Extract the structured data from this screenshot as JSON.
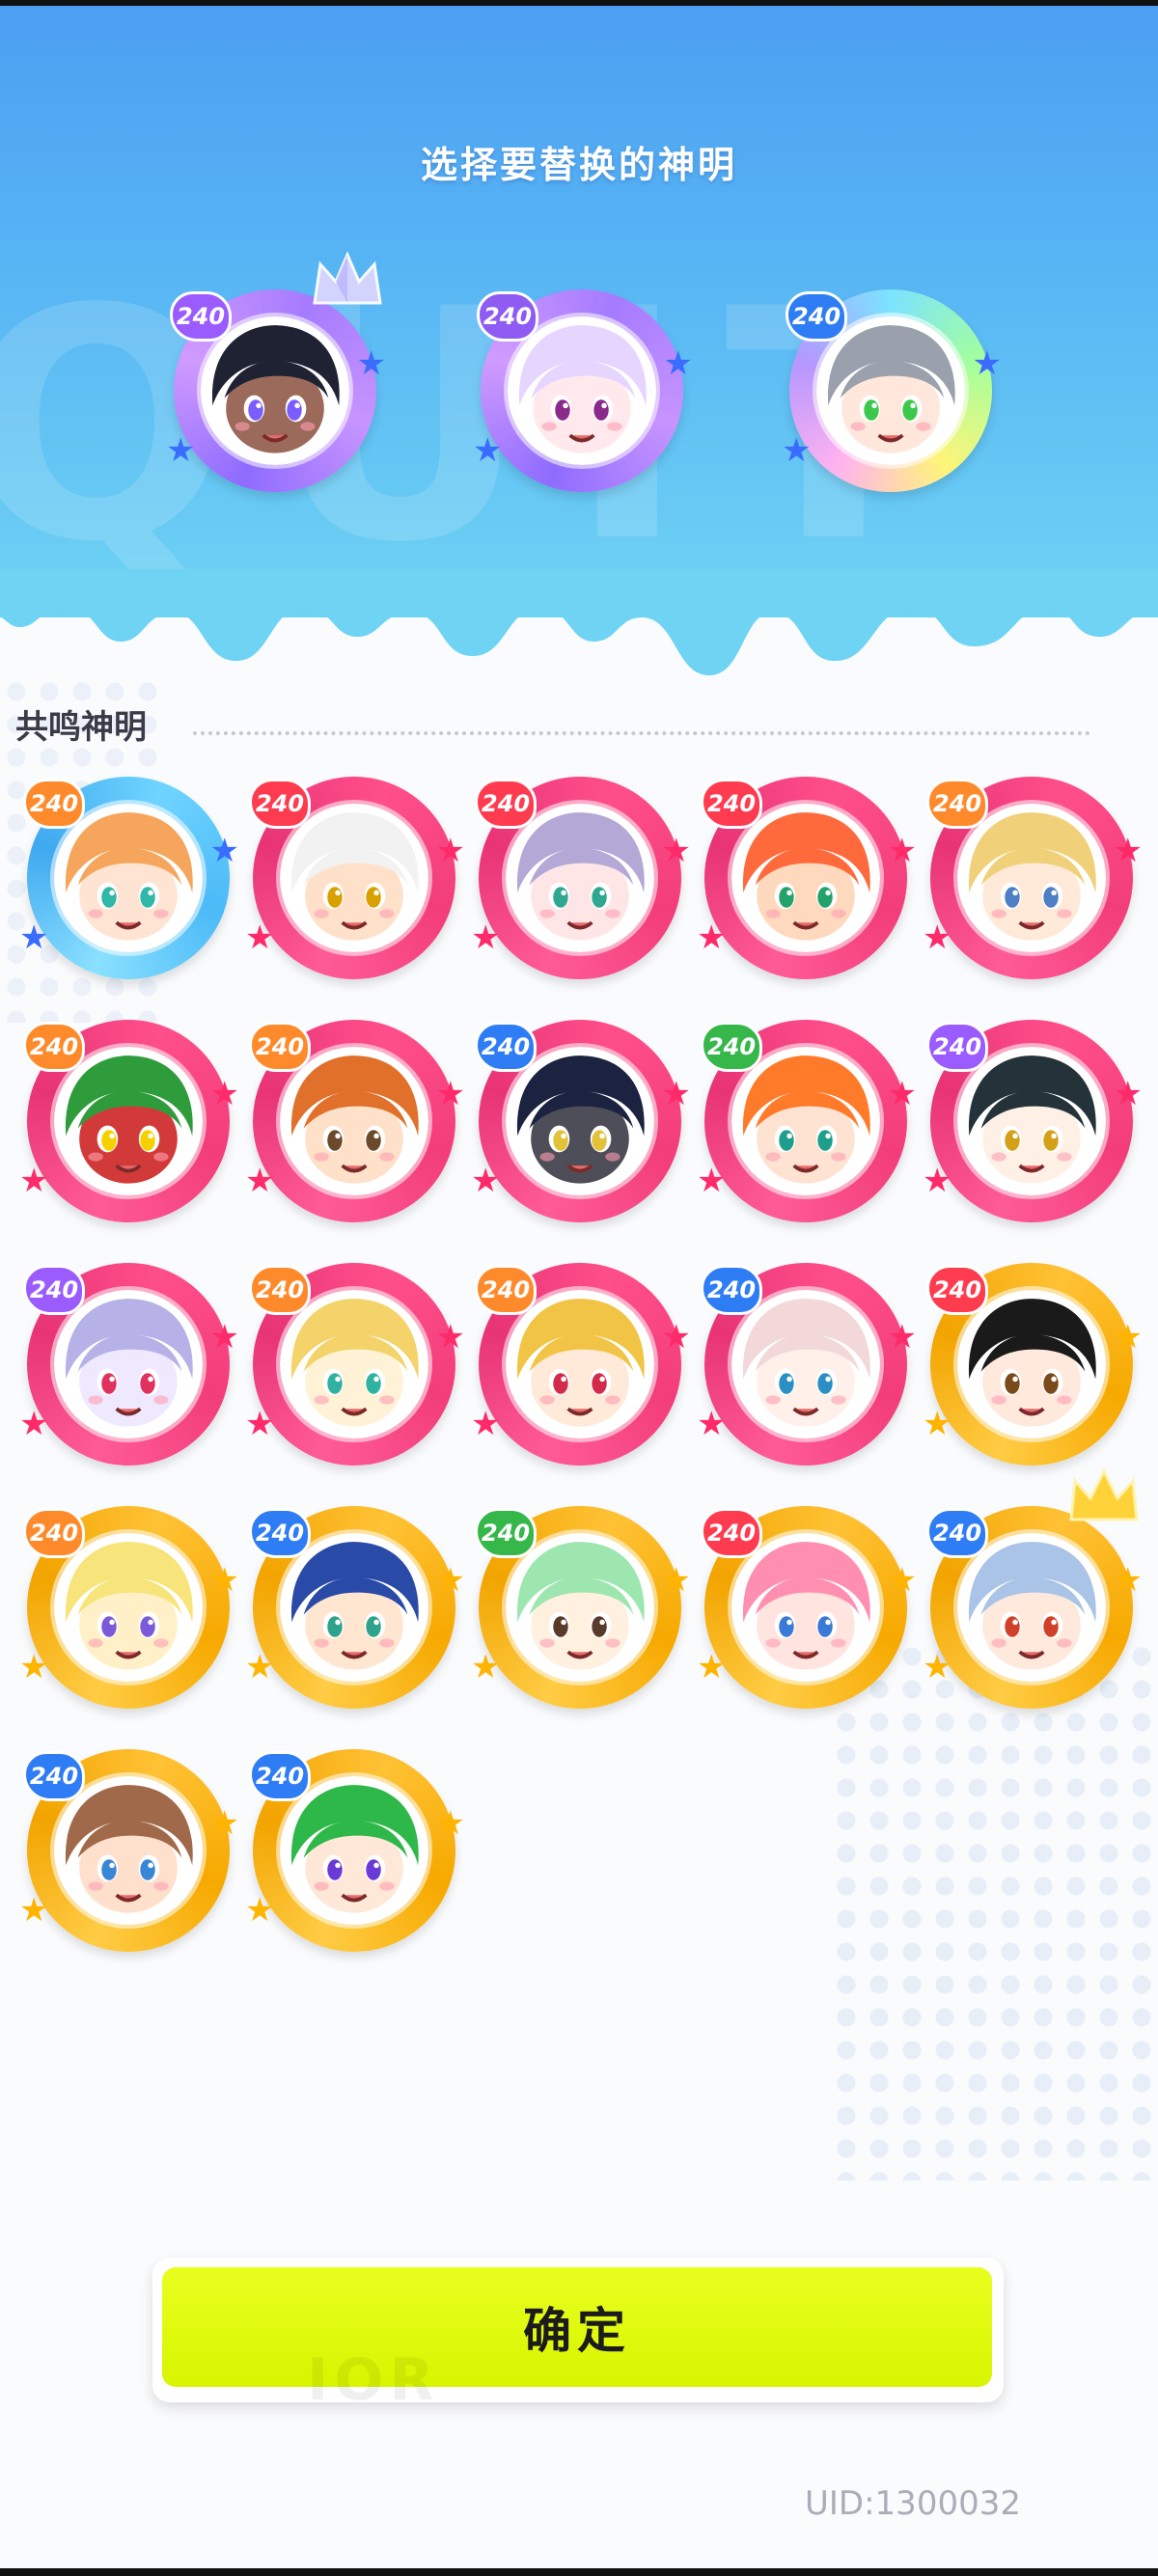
{
  "panel": {
    "title": "选择要替换的神明"
  },
  "selected_slots": [
    {
      "level": "240",
      "level_color": "purple",
      "ring": "purple",
      "crown": "crystal",
      "skin": "#9b6a5a",
      "hair": "#1e2233",
      "eye": "#7b5cff"
    },
    {
      "level": "240",
      "level_color": "violet",
      "ring": "purple",
      "crown": "",
      "skin": "#ffe9ec",
      "hair": "#e6d6ff",
      "eye": "#8a2a8a"
    },
    {
      "level": "240",
      "level_color": "blue",
      "ring": "rainbow",
      "crown": "",
      "skin": "#ffe7dc",
      "hair": "#9aa1ac",
      "eye": "#3cc94b"
    }
  ],
  "section": {
    "title": "共鸣神明"
  },
  "gods": [
    {
      "level": "240",
      "level_color": "orange",
      "ring": "blue",
      "skin": "#ffe4d3",
      "hair": "#f6a65c",
      "eye": "#2fb7a8"
    },
    {
      "level": "240",
      "level_color": "red",
      "ring": "pink",
      "skin": "#ffe0c8",
      "hair": "#f2f2f2",
      "eye": "#d8a000"
    },
    {
      "level": "240",
      "level_color": "red",
      "ring": "pink",
      "skin": "#ffe6e6",
      "hair": "#b3a8d6",
      "eye": "#2fa891"
    },
    {
      "level": "240",
      "level_color": "red",
      "ring": "pink",
      "skin": "#ffd9bd",
      "hair": "#ff6a3c",
      "eye": "#23a36b"
    },
    {
      "level": "240",
      "level_color": "orange",
      "ring": "pink",
      "skin": "#ffe9d8",
      "hair": "#f1d07a",
      "eye": "#4d7fc4"
    },
    {
      "level": "240",
      "level_color": "orange",
      "ring": "pink",
      "skin": "#d23a3a",
      "hair": "#2f9c3c",
      "eye": "#f7d000"
    },
    {
      "level": "240",
      "level_color": "orange",
      "ring": "pink",
      "skin": "#ffe0c8",
      "hair": "#e0702a",
      "eye": "#6a4a2a"
    },
    {
      "level": "240",
      "level_color": "blue",
      "ring": "pink",
      "skin": "#4e4e58",
      "hair": "#1c2340",
      "eye": "#e3c23a"
    },
    {
      "level": "240",
      "level_color": "green",
      "ring": "pink",
      "skin": "#ffe3d2",
      "hair": "#ff7b2a",
      "eye": "#1e9f8c"
    },
    {
      "level": "240",
      "level_color": "purple",
      "ring": "pink",
      "skin": "#fff0e6",
      "hair": "#24323a",
      "eye": "#d4a017"
    },
    {
      "level": "240",
      "level_color": "purple",
      "ring": "pink",
      "skin": "#efe9ff",
      "hair": "#b6b2e8",
      "eye": "#e0315f"
    },
    {
      "level": "240",
      "level_color": "orange",
      "ring": "pink",
      "skin": "#fff2d6",
      "hair": "#f3d36a",
      "eye": "#2fb3a0"
    },
    {
      "level": "240",
      "level_color": "orange",
      "ring": "pink",
      "skin": "#ffe9d8",
      "hair": "#f2c445",
      "eye": "#d22a4a"
    },
    {
      "level": "240",
      "level_color": "blue",
      "ring": "pink",
      "skin": "#fff0ea",
      "hair": "#f2d8d8",
      "eye": "#2a8fc2"
    },
    {
      "level": "240",
      "level_color": "red",
      "ring": "gold",
      "skin": "#ffe8dc",
      "hair": "#1a1a1a",
      "eye": "#7a4a1a"
    },
    {
      "level": "240",
      "level_color": "orange",
      "ring": "gold",
      "skin": "#fff0c8",
      "hair": "#f7e47a",
      "eye": "#7a5ad6"
    },
    {
      "level": "240",
      "level_color": "blue",
      "ring": "gold",
      "skin": "#ffe6d0",
      "hair": "#2a4aa8",
      "eye": "#2fa28c"
    },
    {
      "level": "240",
      "level_color": "green",
      "ring": "gold",
      "skin": "#fff0e0",
      "hair": "#9ee6b0",
      "eye": "#5a3a2a"
    },
    {
      "level": "240",
      "level_color": "red",
      "ring": "gold",
      "skin": "#ffe4e0",
      "hair": "#ff8fb0",
      "eye": "#3a7ad6"
    },
    {
      "level": "240",
      "level_color": "blue",
      "ring": "gold",
      "skin": "#ffe8dc",
      "hair": "#a9c4e6",
      "eye": "#d2402a",
      "crown": "gold"
    },
    {
      "level": "240",
      "level_color": "blue",
      "ring": "gold",
      "skin": "#ffe0cc",
      "hair": "#a0694a",
      "eye": "#3a86d6"
    },
    {
      "level": "240",
      "level_color": "blue",
      "ring": "gold",
      "skin": "#ffe8d8",
      "hair": "#2fb84a",
      "eye": "#6a3ad6"
    }
  ],
  "actions": {
    "confirm_label": "确定",
    "confirm_watermark": "IOR"
  },
  "footer": {
    "uid": "UID:1300032"
  },
  "banner": {
    "watermark": "QUIT"
  }
}
